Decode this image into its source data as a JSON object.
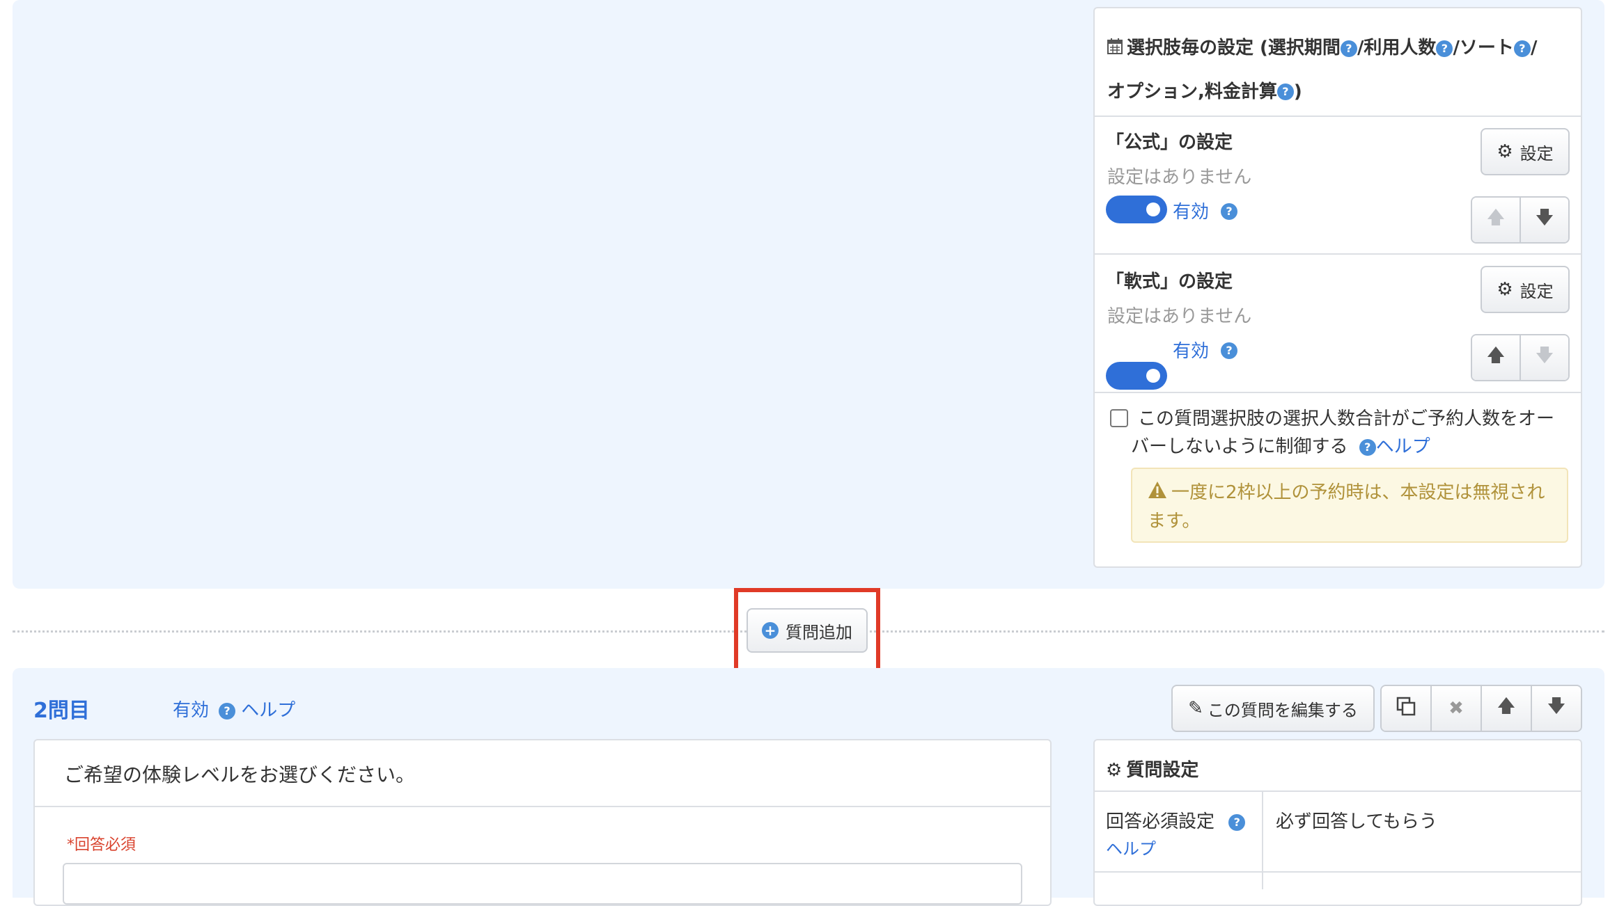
{
  "choice_settings": {
    "title_part1": "選択肢毎の設定 (選択期間",
    "title_part2": "/利用人数",
    "title_part3": "/ソート",
    "title_part4": "/",
    "title_line2a": "オプション,料金計算",
    "title_line2b": ")",
    "items": [
      {
        "name": "「公式」の設定",
        "status": "設定はありません",
        "toggle_label": "有効",
        "settings_label": "設定"
      },
      {
        "name": "「軟式」の設定",
        "status": "設定はありません",
        "toggle_label": "有効",
        "settings_label": "設定"
      }
    ],
    "checkbox_label_line1": "この質問選択肢の選択人数合計がご予約人数をオー",
    "checkbox_label_line2": "バーしないように制御する",
    "help_label": "ヘルプ",
    "warning_line1": "一度に2枠以上の予約時は、本設定は無視され",
    "warning_line2": "ます。"
  },
  "add_question_label": "質問追加",
  "question2": {
    "number_label": "2問目",
    "toggle_label": "有効",
    "help_label": "ヘルプ",
    "edit_label": "この質問を編集する",
    "question_text": "ご希望の体験レベルをお選びください。",
    "required_label": "*回答必須",
    "settings_title": "質問設定",
    "required_setting_label": "回答必須設定",
    "required_setting_help": "ヘルプ",
    "required_setting_value": "必ず回答してもらう"
  },
  "colors": {
    "panel_bg": "#eef5fe",
    "accent_blue": "#2f6fd8",
    "highlight_red": "#e03a27",
    "warning_bg": "#fcf8e3",
    "warning_text": "#b0923a",
    "required_red": "#d9432e"
  }
}
